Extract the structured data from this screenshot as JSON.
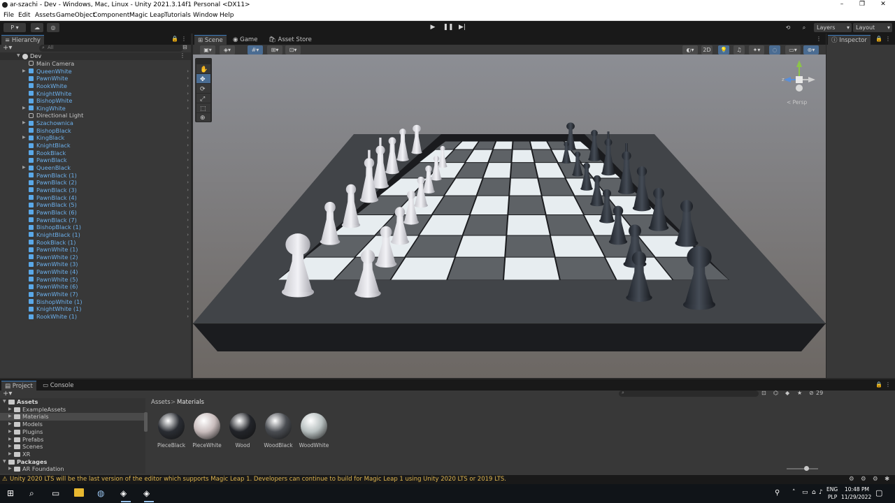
{
  "window": {
    "title": "ar-szachi - Dev - Windows, Mac, Linux - Unity 2021.3.14f1 Personal <DX11>",
    "controls": [
      "–",
      "❐",
      "✕"
    ]
  },
  "menu": [
    "File",
    "Edit",
    "Assets",
    "GameObject",
    "Component",
    "Magic Leap",
    "Tutorials",
    "Window",
    "Help"
  ],
  "toolbar": {
    "account": "P",
    "layers": "Layers",
    "layout": "Layout"
  },
  "hierarchy": {
    "tab": "Hierarchy",
    "search_placeholder": "All",
    "scene": "Dev",
    "items": [
      {
        "label": "Main Camera",
        "type": "go",
        "arrow": false
      },
      {
        "label": "QueenWhite",
        "type": "cube",
        "arrow": true
      },
      {
        "label": "PawnWhite",
        "type": "cube",
        "arrow": false
      },
      {
        "label": "RookWhite",
        "type": "cube",
        "arrow": false
      },
      {
        "label": "KnightWhite",
        "type": "cube",
        "arrow": false
      },
      {
        "label": "BishopWhite",
        "type": "cube",
        "arrow": false
      },
      {
        "label": "KingWhite",
        "type": "cube",
        "arrow": true
      },
      {
        "label": "Directional Light",
        "type": "go",
        "arrow": false
      },
      {
        "label": "Szachownica",
        "type": "cube",
        "arrow": true
      },
      {
        "label": "BishopBlack",
        "type": "cube",
        "arrow": false
      },
      {
        "label": "KingBlack",
        "type": "cube",
        "arrow": true
      },
      {
        "label": "KnightBlack",
        "type": "cube",
        "arrow": false
      },
      {
        "label": "RookBlack",
        "type": "cube",
        "arrow": false
      },
      {
        "label": "PawnBlack",
        "type": "cube",
        "arrow": false
      },
      {
        "label": "QueenBlack",
        "type": "cube",
        "arrow": true
      },
      {
        "label": "PawnBlack (1)",
        "type": "cube",
        "arrow": false
      },
      {
        "label": "PawnBlack (2)",
        "type": "cube",
        "arrow": false
      },
      {
        "label": "PawnBlack (3)",
        "type": "cube",
        "arrow": false
      },
      {
        "label": "PawnBlack (4)",
        "type": "cube",
        "arrow": false
      },
      {
        "label": "PawnBlack (5)",
        "type": "cube",
        "arrow": false
      },
      {
        "label": "PawnBlack (6)",
        "type": "cube",
        "arrow": false
      },
      {
        "label": "PawnBlack (7)",
        "type": "cube",
        "arrow": false
      },
      {
        "label": "BishopBlack (1)",
        "type": "cube",
        "arrow": false
      },
      {
        "label": "KnightBlack (1)",
        "type": "cube",
        "arrow": false
      },
      {
        "label": "RookBlack (1)",
        "type": "cube",
        "arrow": false
      },
      {
        "label": "PawnWhite (1)",
        "type": "cube",
        "arrow": false
      },
      {
        "label": "PawnWhite (2)",
        "type": "cube",
        "arrow": false
      },
      {
        "label": "PawnWhite (3)",
        "type": "cube",
        "arrow": false
      },
      {
        "label": "PawnWhite (4)",
        "type": "cube",
        "arrow": false
      },
      {
        "label": "PawnWhite (5)",
        "type": "cube",
        "arrow": false
      },
      {
        "label": "PawnWhite (6)",
        "type": "cube",
        "arrow": false
      },
      {
        "label": "PawnWhite (7)",
        "type": "cube",
        "arrow": false
      },
      {
        "label": "BishopWhite (1)",
        "type": "cube",
        "arrow": false
      },
      {
        "label": "KnightWhite (1)",
        "type": "cube",
        "arrow": false
      },
      {
        "label": "RookWhite (1)",
        "type": "cube",
        "arrow": false
      }
    ]
  },
  "scene": {
    "tabs": [
      "Scene",
      "Game",
      "Asset Store"
    ],
    "toggle_2d": "2D",
    "gizmo_label": "< Persp",
    "gizmo_axis": "z"
  },
  "inspector": {
    "tab": "Inspector"
  },
  "project": {
    "tabs": [
      "Project",
      "Console"
    ],
    "tree": [
      {
        "label": "Assets",
        "level": 0,
        "bold": true
      },
      {
        "label": "ExampleAssets",
        "level": 1
      },
      {
        "label": "Materials",
        "level": 1,
        "selected": true
      },
      {
        "label": "Models",
        "level": 1
      },
      {
        "label": "Plugins",
        "level": 1
      },
      {
        "label": "Prefabs",
        "level": 1
      },
      {
        "label": "Scenes",
        "level": 1
      },
      {
        "label": "XR",
        "level": 1
      },
      {
        "label": "Packages",
        "level": 0,
        "bold": true
      },
      {
        "label": "AR Foundation",
        "level": 1
      }
    ],
    "breadcrumb": [
      "Assets",
      "Materials"
    ],
    "breadcrumb_sep": ">",
    "count": "29",
    "materials": [
      {
        "name": "PieceBlack",
        "color": "#2a2d33"
      },
      {
        "name": "PieceWhite",
        "color": "#c8bcbc"
      },
      {
        "name": "Wood",
        "color": "#222429"
      },
      {
        "name": "WoodBlack",
        "color": "#4a4d52"
      },
      {
        "name": "WoodWhite",
        "color": "#b8c0c0"
      }
    ]
  },
  "status": {
    "message": "Unity 2020 LTS will be the last version of the editor which supports Magic Leap 1. Developers can continue to build for Magic Leap 1 using Unity 2020 LTS or 2019 LTS."
  },
  "taskbar": {
    "lang": "ENG",
    "locale": "PLP",
    "time": "10:48 PM",
    "date": "11/29/2022"
  },
  "colors": {
    "accent": "#3a79bb",
    "hierarchy_item": "#6cb0ec",
    "warning": "#e0b64e"
  }
}
